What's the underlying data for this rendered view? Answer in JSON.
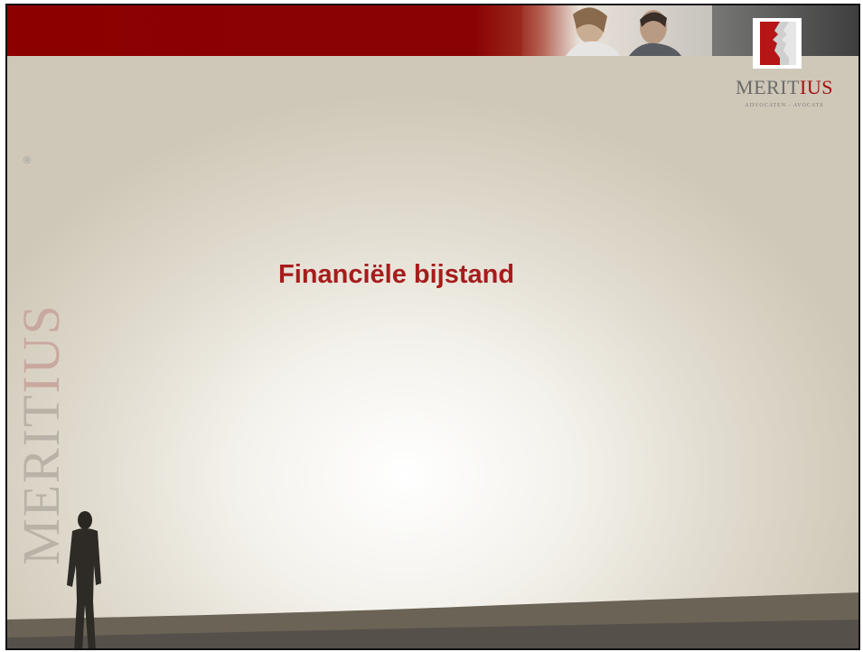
{
  "logo": {
    "name_part1": "MERIT",
    "name_part2": "IUS",
    "tagline": "ADVOCATEN - AVOCATS"
  },
  "side_brand": {
    "part1": "MERIT",
    "part2": "IUS",
    "registered": "®"
  },
  "slide": {
    "title": "Financiële bijstand"
  },
  "colors": {
    "brand_red": "#8c0000",
    "title_red": "#a61c1c"
  }
}
